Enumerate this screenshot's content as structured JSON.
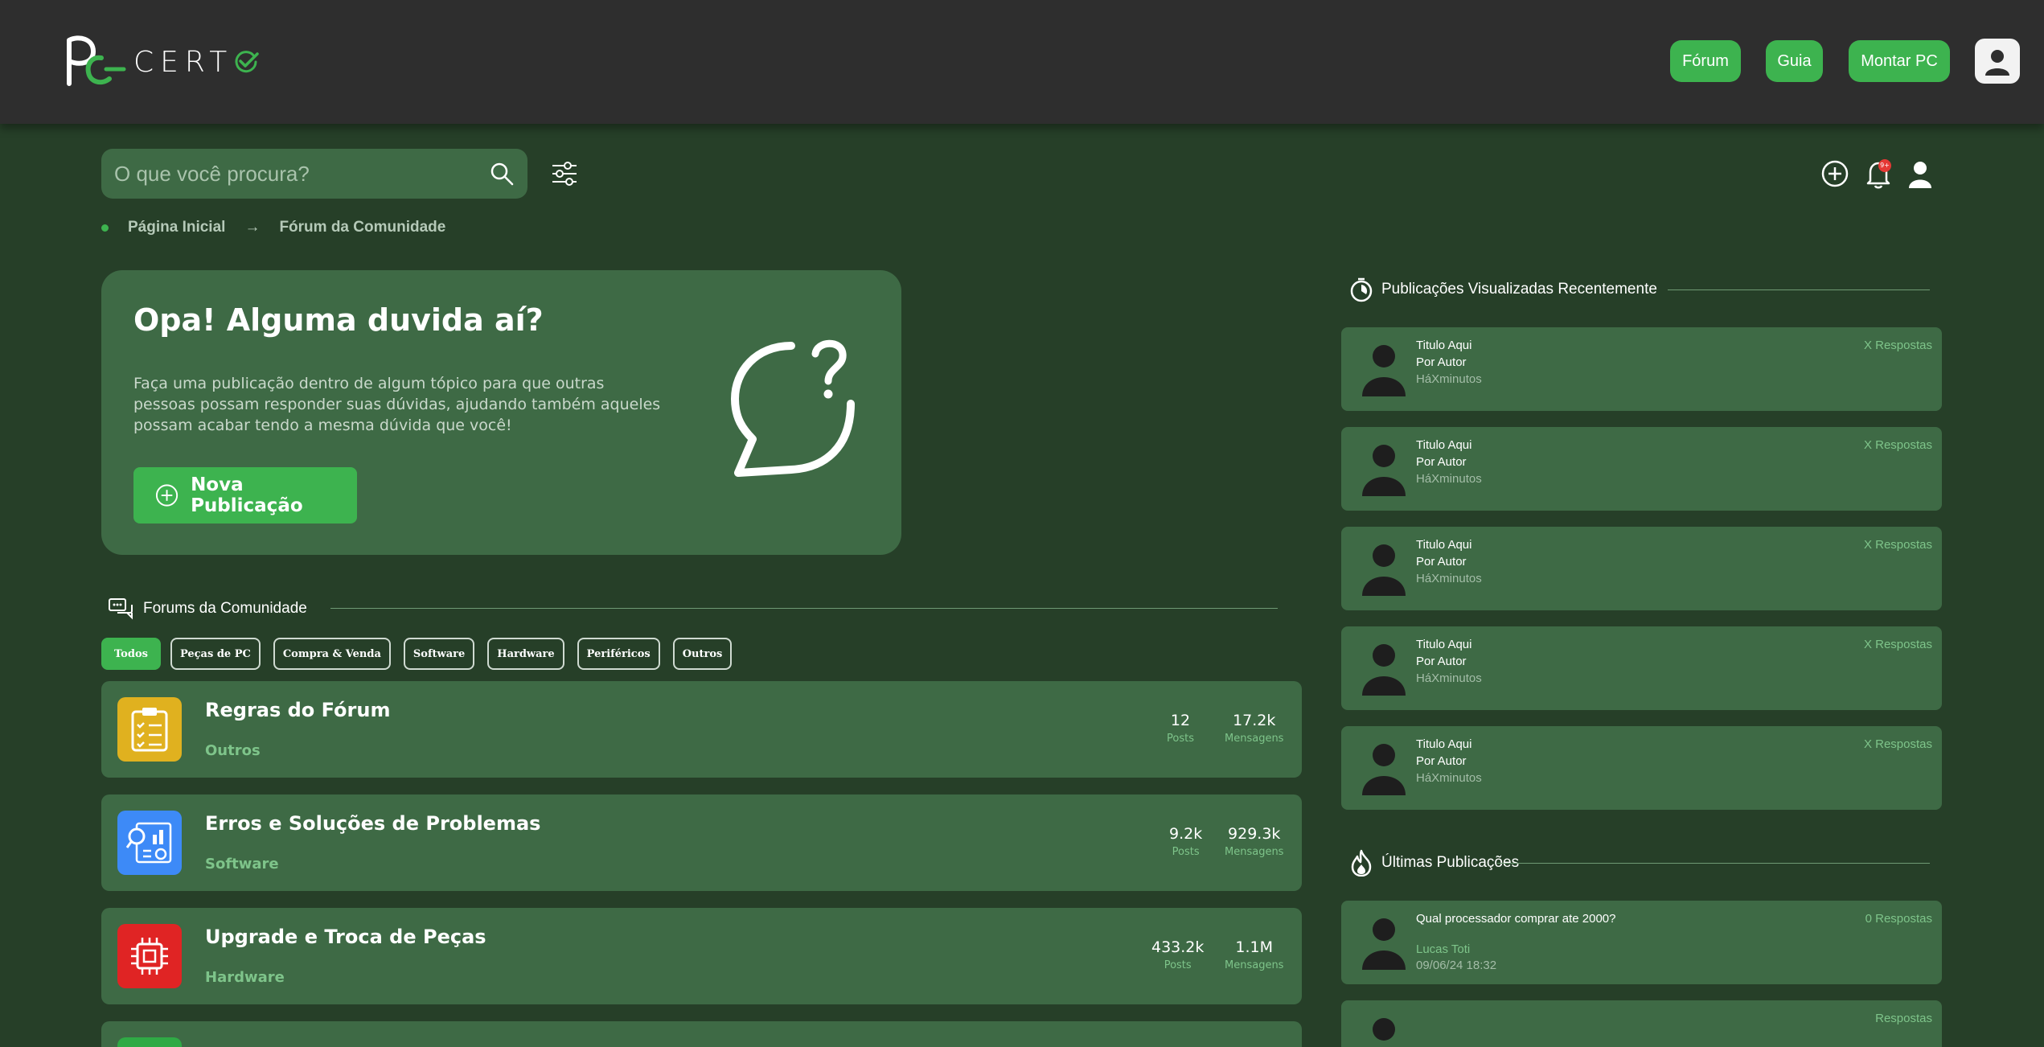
{
  "header": {
    "logo_text": "CERT",
    "nav": [
      {
        "label": "Fórum"
      },
      {
        "label": "Guia"
      },
      {
        "label": "Montar PC"
      }
    ]
  },
  "search": {
    "placeholder": "O que você procura?",
    "value": ""
  },
  "notifications": {
    "badge": "9+"
  },
  "breadcrumb": {
    "home": "Página Inicial",
    "current": "Fórum da Comunidade"
  },
  "hero": {
    "title": "Opa! Alguma duvida aí?",
    "text": "Faça uma publicação dentro de algum tópico para que outras pessoas possam responder suas dúvidas, ajudando também aqueles possam acabar tendo a mesma dúvida que você!",
    "button": "Nova Publicação"
  },
  "forums": {
    "heading": "Forums da Comunidade",
    "filters": [
      "Todos",
      "Peças de PC",
      "Compra & Venda",
      "Software",
      "Hardware",
      "Periféricos",
      "Outros"
    ],
    "active_filter": "Todos",
    "items": [
      {
        "title": "Regras do Fórum",
        "category": "Outros",
        "posts": "12",
        "posts_label": "Posts",
        "messages": "17.2k",
        "messages_label": "Mensagens",
        "icon": "clipboard-icon",
        "color": "#e0b11f"
      },
      {
        "title": "Erros e Soluções de Problemas",
        "category": "Software",
        "posts": "9.2k",
        "posts_label": "Posts",
        "messages": "929.3k",
        "messages_label": "Mensagens",
        "icon": "analytics-icon",
        "color": "#3d8af7"
      },
      {
        "title": "Upgrade e Troca de Peças",
        "category": "Hardware",
        "posts": "433.2k",
        "posts_label": "Posts",
        "messages": "1.1M",
        "messages_label": "Mensagens",
        "icon": "cpu-icon",
        "color": "#e02424"
      }
    ]
  },
  "recent": {
    "heading": "Publicações Visualizadas Recentemente",
    "items": [
      {
        "title": "Titulo Aqui",
        "author": "Por Autor",
        "time": "HáXminutos",
        "replies": "X Respostas"
      },
      {
        "title": "Titulo Aqui",
        "author": "Por Autor",
        "time": "HáXminutos",
        "replies": "X Respostas"
      },
      {
        "title": "Titulo Aqui",
        "author": "Por Autor",
        "time": "HáXminutos",
        "replies": "X Respostas"
      },
      {
        "title": "Titulo Aqui",
        "author": "Por Autor",
        "time": "HáXminutos",
        "replies": "X Respostas"
      },
      {
        "title": "Titulo Aqui",
        "author": "Por Autor",
        "time": "HáXminutos",
        "replies": "X Respostas"
      }
    ]
  },
  "latest": {
    "heading": "Últimas Publicações",
    "items": [
      {
        "title": "Qual processador comprar ate 2000?",
        "author": "Lucas Toti",
        "time": "09/06/24 18:32",
        "replies": "0 Respostas"
      },
      {
        "title": "",
        "author": "",
        "time": "",
        "replies": "Respostas"
      }
    ]
  },
  "colors": {
    "background": "#263f28",
    "card": "#3e6a45",
    "accent": "#3db34f",
    "header": "#2e2e2e"
  }
}
